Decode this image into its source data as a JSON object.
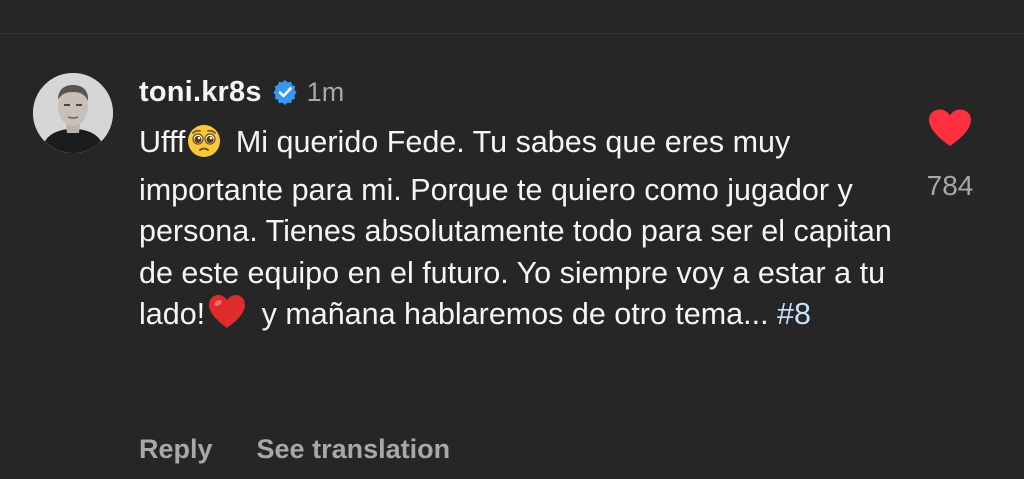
{
  "comment": {
    "username": "toni.kr8s",
    "verified": true,
    "timestamp": "1m",
    "text_before_emoji": "Ufff",
    "text_main_1": "Mi querido Fede. Tu sabes que eres muy importante para mi. Porque te quiero como jugador y persona. Tienes absolutamente todo para ser el capitan de este equipo en el futuro. Yo siempre voy a estar a tu lado!",
    "text_main_2": "y mañana hablaremos de otro tema...",
    "hashtag": "#8",
    "emoji_1": "pleading-face-emoji",
    "emoji_2": "red-heart-emoji",
    "liked": true,
    "like_count": "784",
    "accent_color": "#ff3040",
    "verified_color": "#3897f0"
  },
  "actions": {
    "reply_label": "Reply",
    "translate_label": "See translation"
  }
}
